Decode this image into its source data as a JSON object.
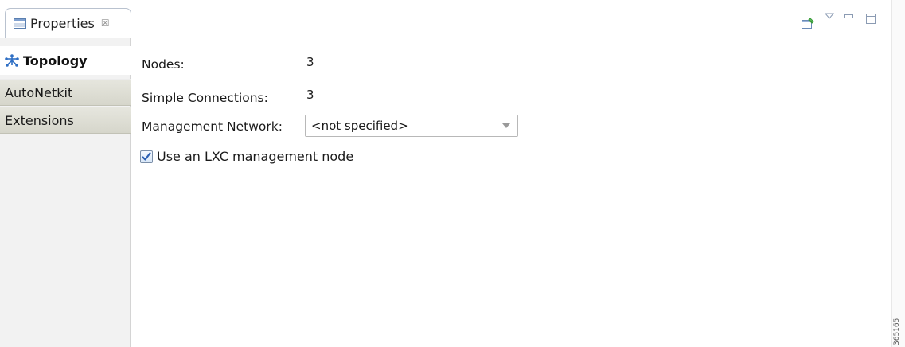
{
  "view_tab": {
    "label": "Properties",
    "close_symbol": "☒",
    "icon": "properties-table-icon"
  },
  "header_actions": [
    {
      "name": "pin-to-view-icon"
    },
    {
      "name": "view-menu-icon"
    },
    {
      "name": "minimize-icon"
    },
    {
      "name": "maximize-icon"
    }
  ],
  "page_tabs": [
    {
      "label": "Topology",
      "selected": true,
      "icon": "topology-icon"
    },
    {
      "label": "AutoNetkit",
      "selected": false
    },
    {
      "label": "Extensions",
      "selected": false
    }
  ],
  "topology": {
    "nodes_label": "Nodes:",
    "nodes_value": "3",
    "connections_label": "Simple Connections:",
    "connections_value": "3",
    "mgmt_label": "Management Network:",
    "mgmt_value": "<not specified>",
    "lxc_label": "Use an LXC management node",
    "lxc_checked": true
  },
  "figure_number": "365165",
  "colors": {
    "accent": "#2f6fc4",
    "tab_gradient_top": "#e6e6de",
    "tab_gradient_bottom": "#d6d6cb"
  }
}
